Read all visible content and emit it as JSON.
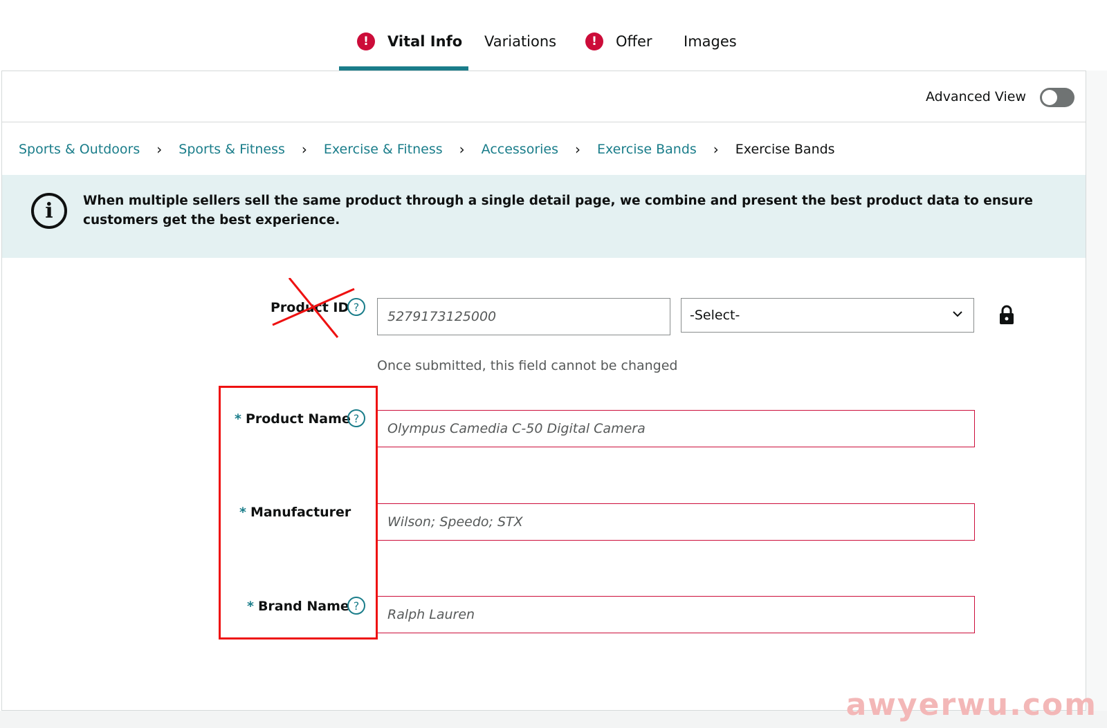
{
  "tabs": [
    {
      "label": "Vital Info",
      "alert": "!",
      "active": true
    },
    {
      "label": "Variations"
    },
    {
      "label": "Offer",
      "alert": "!"
    },
    {
      "label": "Images"
    }
  ],
  "advanced_view": {
    "label": "Advanced View",
    "enabled": false
  },
  "breadcrumb": [
    "Sports & Outdoors",
    "Sports & Fitness",
    "Exercise & Fitness",
    "Accessories",
    "Exercise Bands",
    "Exercise Bands"
  ],
  "info_banner": {
    "icon": "info-icon",
    "text": "When multiple sellers sell the same product through a single detail page, we combine and present the best product data to ensure customers get the best experience."
  },
  "form": {
    "product_id": {
      "label": "Product ID",
      "placeholder": "5279173125000",
      "select_value": "-Select-",
      "hint": "Once submitted, this field cannot be changed"
    },
    "product_name": {
      "label": "Product Name",
      "placeholder": "Olympus Camedia C-50 Digital Camera"
    },
    "manufacturer": {
      "label": "Manufacturer",
      "placeholder": "Wilson; Speedo; STX"
    },
    "brand_name": {
      "label": "Brand Name",
      "placeholder": "Ralph Lauren"
    },
    "required_marker": "*",
    "help_glyph": "?"
  },
  "colors": {
    "accent": "#1a7d8a",
    "error": "#cc0c39",
    "annotation": "#ee1111"
  },
  "watermark": "awyerwu.com"
}
